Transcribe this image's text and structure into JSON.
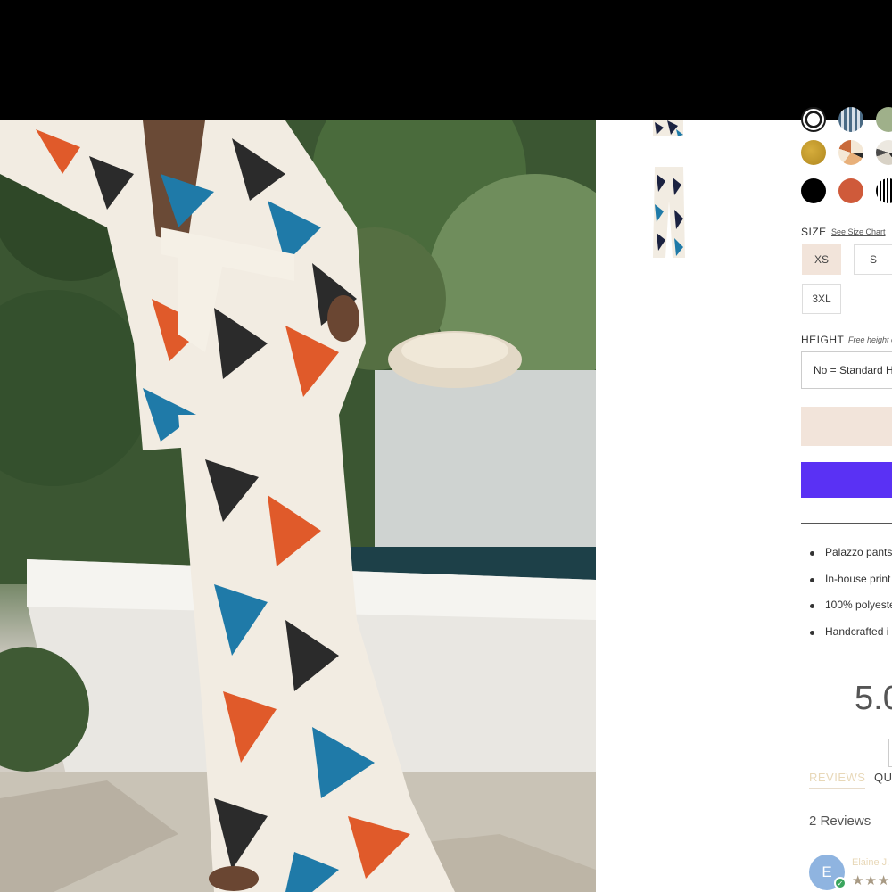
{
  "product": {
    "main_image_alt": "Model wearing geometric print wrap top and palazzo pants",
    "thumbnails": [
      "top-detail",
      "pants-front"
    ]
  },
  "colors": {
    "swatches": [
      {
        "name": "swatch-1",
        "color": "#1a1a1a",
        "style": "ring"
      },
      {
        "name": "swatch-2",
        "color": "#4a6a84",
        "style": "pattern"
      },
      {
        "name": "swatch-3",
        "color": "#9fb08a",
        "style": "solid"
      },
      {
        "name": "mustard",
        "color": "#c49a2a",
        "style": "solid"
      },
      {
        "name": "beige-print",
        "color": "#e8cba8",
        "style": "pattern"
      },
      {
        "name": "mono-print",
        "color": "#d8d2c6",
        "style": "pattern"
      },
      {
        "name": "black",
        "color": "#000000",
        "style": "solid"
      },
      {
        "name": "rust",
        "color": "#cf5a3a",
        "style": "solid"
      },
      {
        "name": "stripe",
        "color": "#000000",
        "style": "stripe"
      }
    ],
    "selected_border": "#1a1a1a"
  },
  "size": {
    "label": "SIZE",
    "chart_link": "See Size Chart",
    "options": [
      "XS",
      "S",
      "3XL"
    ],
    "selected": "XS"
  },
  "height": {
    "label": "HEIGHT",
    "note": "Free height c",
    "selected": "No = Standard H"
  },
  "buttons": {
    "add_to_cart_color": "#f2e4da",
    "buy_now_color": "#5a31f4"
  },
  "features": [
    "Palazzo pants",
    "In-house print",
    "100% polyeste",
    "Handcrafted i"
  ],
  "reviews": {
    "average": "5.0",
    "tabs": [
      "REVIEWS",
      "QU"
    ],
    "count_label": "2 Reviews",
    "first": {
      "initial": "E",
      "name": "Elaine J.",
      "stars": "★★★"
    }
  }
}
